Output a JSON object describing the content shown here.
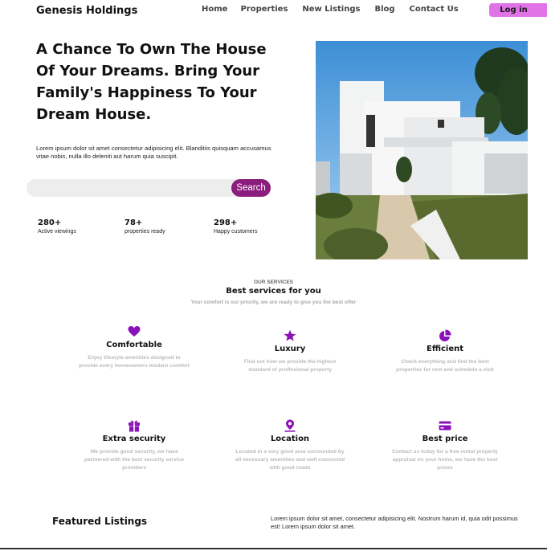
{
  "header": {
    "brand": "Genesis Holdings",
    "nav": [
      "Home",
      "Properties",
      "New Listings",
      "Blog",
      "Contact Us"
    ],
    "login_label": "Log in",
    "accent": "#e073e6"
  },
  "hero": {
    "title": "A Chance To Own The House Of Your Dreams. Bring Your Family's Happiness To Your Dream House.",
    "text": "Lorem ipsum dolor sit amet consectetur adipisicing elit. Blanditiis quisquam accusamus vitae nobis, nulla illo deleniti aut harum quia suscipit.",
    "search_placeholder": "",
    "search_label": "Search",
    "search_color": "#8a1d7d",
    "stats": [
      {
        "num": "280+",
        "label": "Active viewings"
      },
      {
        "num": "78+",
        "label": "properties ready"
      },
      {
        "num": "298+",
        "label": "Happy customers"
      }
    ],
    "image": "white-modern-house-photo"
  },
  "services": {
    "eyebrow": "OUR SERVICES",
    "heading": "Best services for you",
    "sub": "Your comfort is our priority, we are ready to give you the best offer",
    "icon_color": "#8b12b8",
    "items": [
      {
        "icon": "heart-icon",
        "title": "Comfortable",
        "desc": "Enjoy lifestyle amenities designed to provide every homeowners modern comfort"
      },
      {
        "icon": "star-icon",
        "title": "Luxury",
        "desc": "Find out how we provide the highest standard of proffesional property"
      },
      {
        "icon": "pie-chart-icon",
        "title": "Efficient",
        "desc": "Check everything and find the best properties for rent and schedule a visit"
      },
      {
        "icon": "gift-icon",
        "title": "Extra security",
        "desc": "We provide good security, we have partnered with the best security service providers"
      },
      {
        "icon": "location-pin-icon",
        "title": "Location",
        "desc": "Located in a very good area sorrounded by all necessary amenities and well connected with good roads"
      },
      {
        "icon": "credit-card-icon",
        "title": "Best price",
        "desc": "Contact us today for a free rental property appraisal on your home, we have the best prices"
      }
    ]
  },
  "featured": {
    "title": "Featured Listings",
    "text": "Lorem ipsum dolor sit amet, consectetur adipisicing elit. Nostrum harum id, quia odit possimus est! Lorem ipsum dolor sit amet."
  }
}
